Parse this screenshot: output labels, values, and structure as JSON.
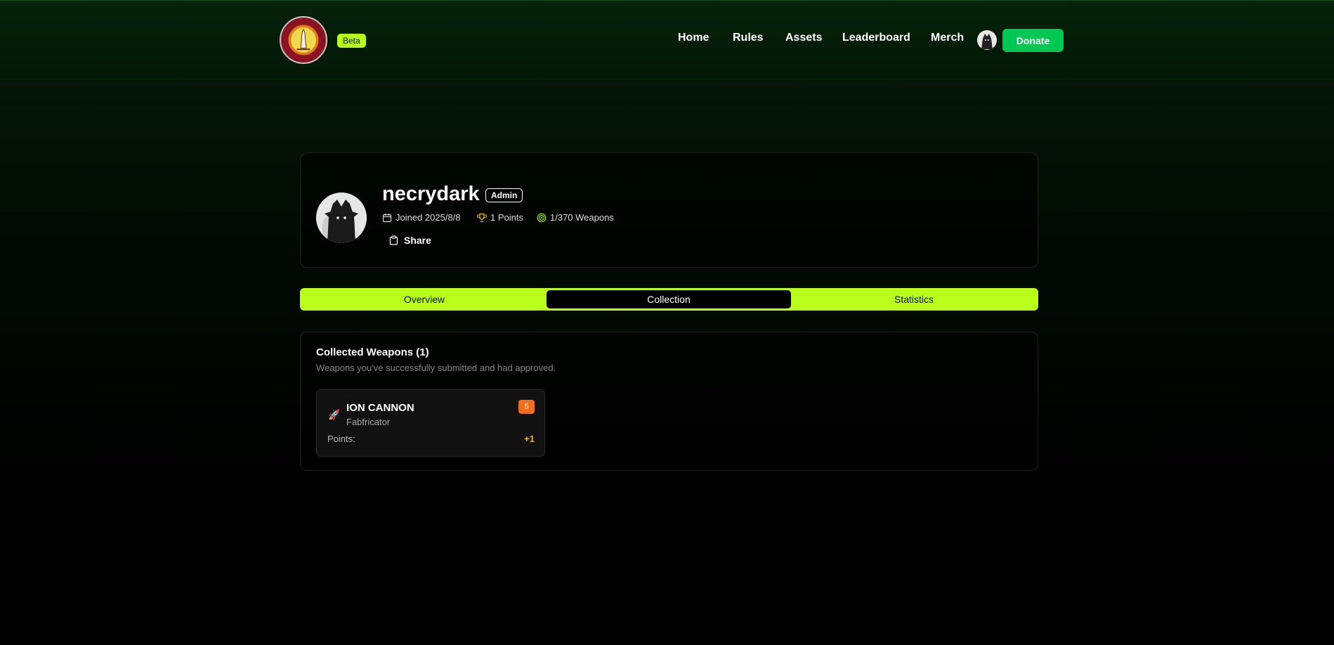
{
  "header": {
    "logo_icon": "community-seal-logo",
    "beta_label": "Beta",
    "nav": [
      {
        "label": "Home"
      },
      {
        "label": "Rules"
      },
      {
        "label": "Assets"
      },
      {
        "label": "Leaderboard"
      },
      {
        "label": "Merch"
      }
    ],
    "user_avatar_icon": "user-avatar",
    "donate_label": "Donate"
  },
  "profile": {
    "username": "necrydark",
    "role": "Admin",
    "joined": "Joined 2025/8/8",
    "points": "1 Points",
    "weapons": "1/370 Weapons",
    "share_label": "Share"
  },
  "tabs": {
    "items": [
      {
        "label": "Overview"
      },
      {
        "label": "Collection"
      },
      {
        "label": "Statistics"
      }
    ],
    "active": "Collection"
  },
  "collection": {
    "title": "Collected Weapons (1)",
    "subtitle": "Weapons you've successfully submitted and had approved.",
    "weapons": [
      {
        "icon": "rocket-icon",
        "name": "ION CANNON",
        "manufacturer": "Fabfricator",
        "tier": "5",
        "points_label": "Points:",
        "points_value": "+1"
      }
    ]
  },
  "colors": {
    "accent": "#b8ff1c",
    "donate": "#00c853",
    "tier_badge": "#f26d1d",
    "points": "#f5b400"
  }
}
